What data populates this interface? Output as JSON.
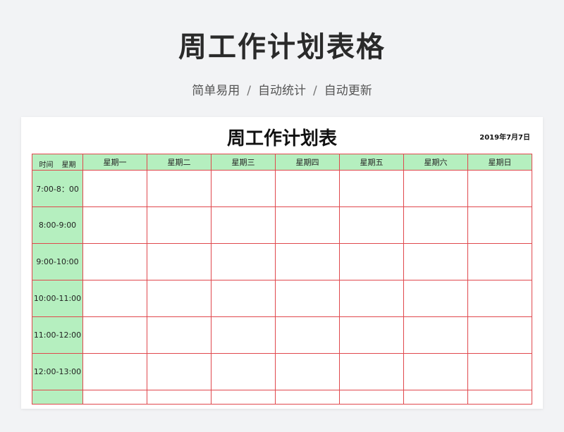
{
  "header": {
    "title": "周工作计划表格",
    "subtitle": {
      "part1": "简单易用",
      "sep1": "/",
      "part2": "自动统计",
      "sep2": "/",
      "part3": "自动更新"
    }
  },
  "sheet": {
    "title": "周工作计划表",
    "date": "2019年7月7日",
    "corner_left": "时间",
    "corner_right": "星期",
    "days": [
      "星期一",
      "星期二",
      "星期三",
      "星期四",
      "星期五",
      "星期六",
      "星期日"
    ],
    "time_slots": [
      "7:00-8：00",
      "8:00-9:00",
      "9:00-10:00",
      "10:00-11:00",
      "11:00-12:00",
      "12:00-13:00",
      ""
    ]
  },
  "colors": {
    "grid_border": "#e0484d",
    "header_fill": "#b5efbf",
    "page_background": "#f2f3f5"
  }
}
